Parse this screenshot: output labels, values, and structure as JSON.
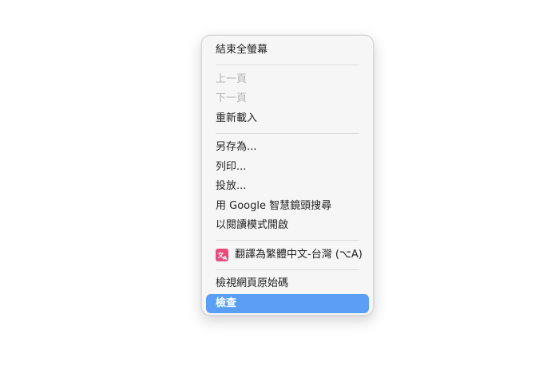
{
  "context_menu": {
    "items": [
      {
        "label": "結束全螢幕",
        "enabled": true
      },
      {
        "label": "上一頁",
        "enabled": false
      },
      {
        "label": "下一頁",
        "enabled": false
      },
      {
        "label": "重新載入",
        "enabled": true
      },
      {
        "label": "另存為...",
        "enabled": true
      },
      {
        "label": "列印...",
        "enabled": true
      },
      {
        "label": "投放...",
        "enabled": true
      },
      {
        "label": "用 Google 智慧鏡頭搜尋",
        "enabled": true
      },
      {
        "label": "以閱讀模式開啟",
        "enabled": true
      },
      {
        "label": "翻譯為繁體中文-台灣 (⌥A)",
        "enabled": true,
        "icon": "translate-icon",
        "icon_color": "#e84a7a"
      },
      {
        "label": "檢視網頁原始碼",
        "enabled": true
      },
      {
        "label": "檢查",
        "enabled": true,
        "highlighted": true
      }
    ],
    "highlight_color": "#5a9ff5"
  }
}
